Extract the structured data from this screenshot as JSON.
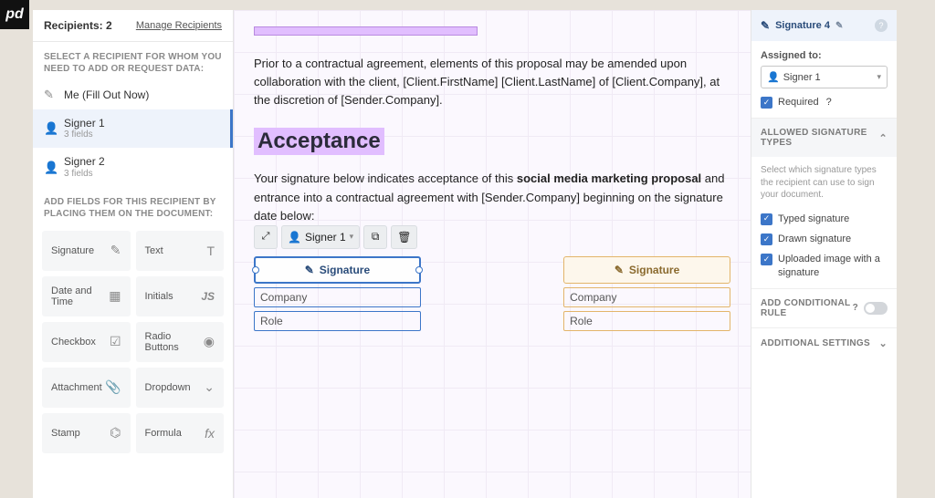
{
  "logo_text": "pd",
  "left": {
    "recipients_label": "Recipients:",
    "recipients_count": "2",
    "manage_link": "Manage Recipients",
    "select_heading": "SELECT A RECIPIENT FOR WHOM YOU NEED TO ADD OR REQUEST DATA:",
    "me_label": "Me (Fill Out Now)",
    "signer1_name": "Signer 1",
    "signer1_sub": "3 fields",
    "signer2_name": "Signer 2",
    "signer2_sub": "3 fields",
    "fields_heading": "ADD FIELDS FOR THIS RECIPIENT BY PLACING THEM ON THE DOCUMENT:",
    "tiles": {
      "signature": "Signature",
      "text": "Text",
      "date_time": "Date and Time",
      "initials": "Initials",
      "checkbox": "Checkbox",
      "radio": "Radio Buttons",
      "attachment": "Attachment",
      "dropdown": "Dropdown",
      "stamp": "Stamp",
      "formula": "Formula"
    }
  },
  "doc": {
    "para1": "Prior to a contractual agreement, elements of this proposal may be amended upon collaboration with the client, [Client.FirstName] [Client.LastName] of [Client.Company], at the discretion of [Sender.Company].",
    "heading": "Acceptance",
    "para2_a": "Your signature below indicates acceptance of this ",
    "para2_bold": "social media marketing proposal",
    "para2_b": " and entrance into a contractual agreement with [Sender.Company] beginning on the signature date below:",
    "toolbar_signer": "Signer 1",
    "block1_sig": "Signature",
    "block1_company": "Company",
    "block1_role": "Role",
    "block2_sig": "Signature",
    "block2_company": "Company",
    "block2_role": "Role"
  },
  "right": {
    "header_title": "Signature 4",
    "assigned_label": "Assigned to:",
    "assigned_value": "Signer 1",
    "required_label": "Required",
    "allowed_header": "ALLOWED SIGNATURE TYPES",
    "allowed_note": "Select which signature types the recipient can use to sign your document.",
    "typed": "Typed signature",
    "drawn": "Drawn signature",
    "uploaded": "Uploaded image with a signature",
    "conditional_header": "ADD CONDITIONAL RULE",
    "additional_header": "ADDITIONAL SETTINGS"
  }
}
